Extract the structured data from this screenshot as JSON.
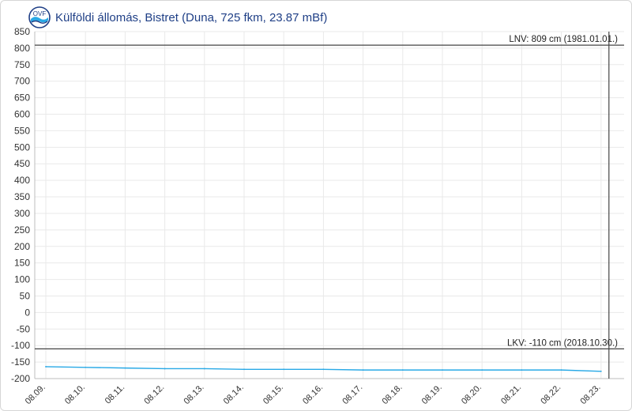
{
  "chart_data": {
    "type": "line",
    "title": "Külföldi állomás, Bistret (Duna, 725 fkm, 23.87 mBf)",
    "xlabel": "",
    "ylabel": "",
    "ylim": [
      -200,
      850
    ],
    "yticks": [
      -200,
      -150,
      -100,
      -50,
      0,
      50,
      100,
      150,
      200,
      250,
      300,
      350,
      400,
      450,
      500,
      550,
      600,
      650,
      700,
      750,
      800,
      850
    ],
    "categories": [
      "08.09.",
      "08.10.",
      "08.11.",
      "08.12.",
      "08.13.",
      "08.14.",
      "08.15.",
      "08.16.",
      "08.17.",
      "08.18.",
      "08.19.",
      "08.20.",
      "08.21.",
      "08.22.",
      "08.23."
    ],
    "series": [
      {
        "values": [
          -164,
          -166,
          -168,
          -170,
          -170,
          -172,
          -172,
          -172,
          -174,
          -174,
          -174,
          -174,
          -174,
          -174,
          -178
        ],
        "color": "#29a9e6"
      }
    ],
    "reference_lines": [
      {
        "value": 809,
        "label": "LNV: 809 cm (1981.01.01.)"
      },
      {
        "value": -110,
        "label": "LKV: -110 cm (2018.10.30.)"
      }
    ],
    "current_marker": "08.23.",
    "grid": true,
    "legend": "none"
  },
  "colors": {
    "title": "#1f3f86",
    "series": "#29a9e6",
    "reference": "#444444",
    "grid": "#e9e9e9",
    "axis_text": "#333333"
  },
  "header": {
    "logo_icon": "ovf-logo-icon"
  }
}
